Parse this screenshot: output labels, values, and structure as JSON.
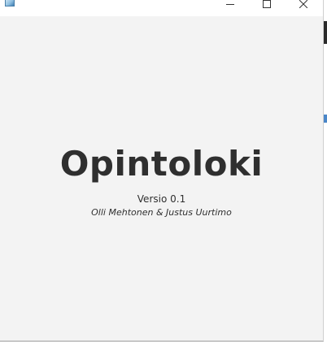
{
  "window": {
    "title_bar": {
      "minimize_icon": "minimize-icon",
      "maximize_icon": "maximize-icon",
      "close_icon": "close-icon"
    }
  },
  "splash": {
    "title": "Opintoloki",
    "version": "Versio 0.1",
    "authors": "Olli Mehtonen & Justus Uurtimo"
  },
  "colors": {
    "background": "#f3f3f3",
    "text": "#2f2f2f"
  }
}
